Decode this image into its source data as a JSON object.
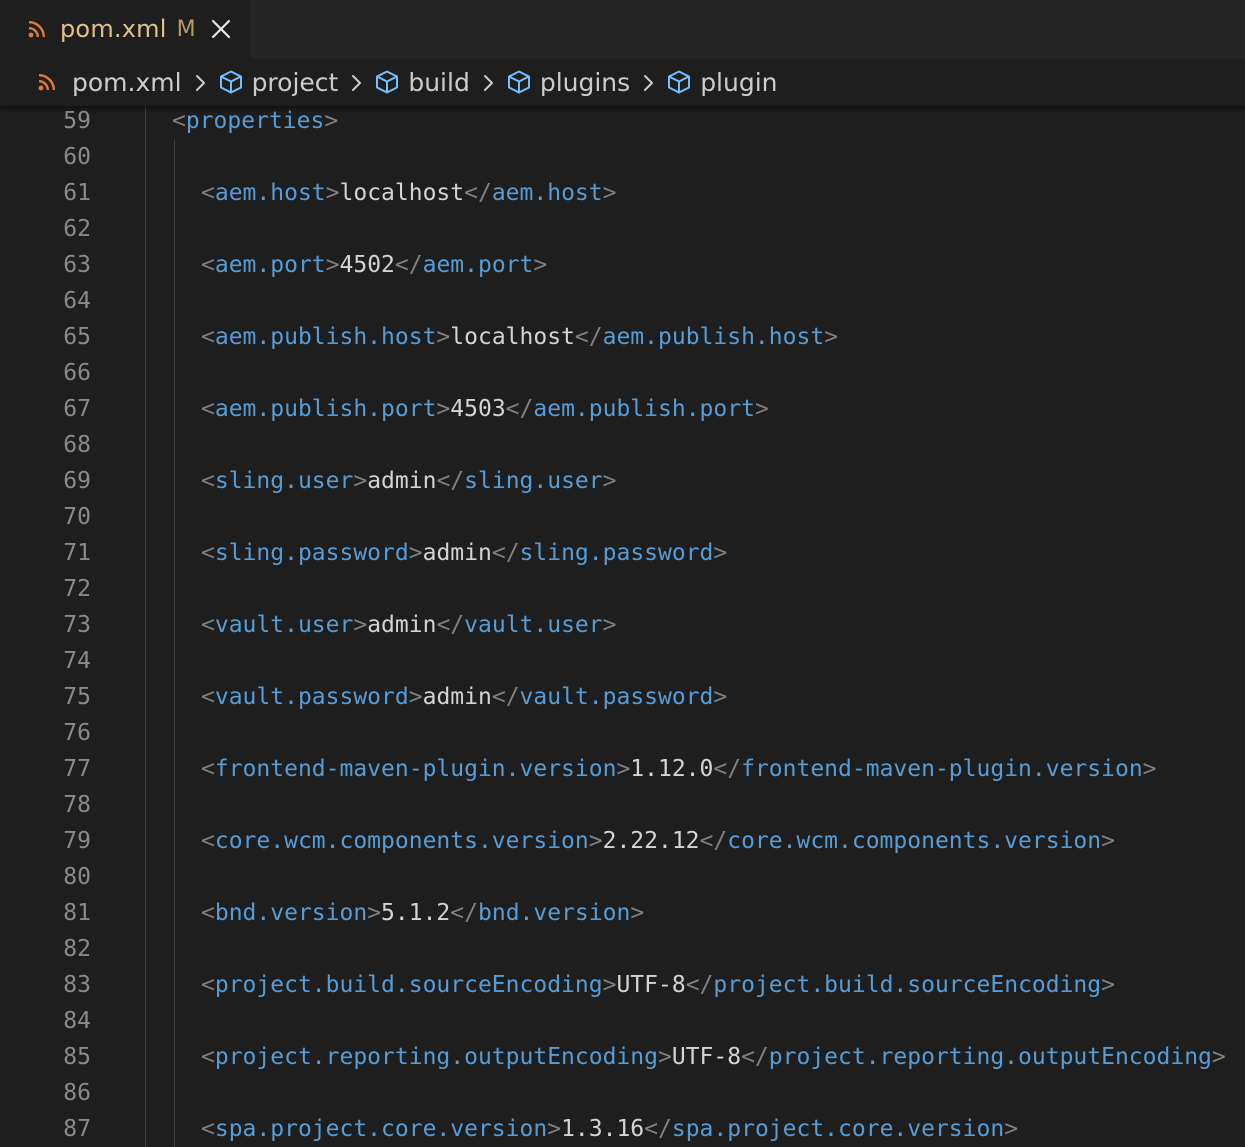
{
  "tab": {
    "title": "pom.xml",
    "status": "M"
  },
  "breadcrumb": {
    "file": "pom.xml",
    "items": [
      "project",
      "build",
      "plugins",
      "plugin"
    ]
  },
  "icons": {
    "file": "rss-icon",
    "element": "cube-icon",
    "separator": "chevron-right-icon",
    "close": "close-icon"
  },
  "colors": {
    "tag": "#569cd6",
    "punctuation": "#808080",
    "text": "#d4d4d4",
    "line_number": "#8a8a8a",
    "modified": "#e2c08d",
    "rss": "#e37933",
    "cube": "#75beff"
  },
  "editor": {
    "lines": [
      {
        "num": "59",
        "open": "properties",
        "value": "",
        "close": ""
      },
      {
        "num": "60",
        "open": "",
        "value": "",
        "close": ""
      },
      {
        "num": "61",
        "open": "aem.host",
        "value": "localhost",
        "close": "aem.host"
      },
      {
        "num": "62",
        "open": "",
        "value": "",
        "close": ""
      },
      {
        "num": "63",
        "open": "aem.port",
        "value": "4502",
        "close": "aem.port"
      },
      {
        "num": "64",
        "open": "",
        "value": "",
        "close": ""
      },
      {
        "num": "65",
        "open": "aem.publish.host",
        "value": "localhost",
        "close": "aem.publish.host"
      },
      {
        "num": "66",
        "open": "",
        "value": "",
        "close": ""
      },
      {
        "num": "67",
        "open": "aem.publish.port",
        "value": "4503",
        "close": "aem.publish.port"
      },
      {
        "num": "68",
        "open": "",
        "value": "",
        "close": ""
      },
      {
        "num": "69",
        "open": "sling.user",
        "value": "admin",
        "close": "sling.user"
      },
      {
        "num": "70",
        "open": "",
        "value": "",
        "close": ""
      },
      {
        "num": "71",
        "open": "sling.password",
        "value": "admin",
        "close": "sling.password"
      },
      {
        "num": "72",
        "open": "",
        "value": "",
        "close": ""
      },
      {
        "num": "73",
        "open": "vault.user",
        "value": "admin",
        "close": "vault.user"
      },
      {
        "num": "74",
        "open": "",
        "value": "",
        "close": ""
      },
      {
        "num": "75",
        "open": "vault.password",
        "value": "admin",
        "close": "vault.password"
      },
      {
        "num": "76",
        "open": "",
        "value": "",
        "close": ""
      },
      {
        "num": "77",
        "open": "frontend-maven-plugin.version",
        "value": "1.12.0",
        "close": "frontend-maven-plugin.version"
      },
      {
        "num": "78",
        "open": "",
        "value": "",
        "close": ""
      },
      {
        "num": "79",
        "open": "core.wcm.components.version",
        "value": "2.22.12",
        "close": "core.wcm.components.version"
      },
      {
        "num": "80",
        "open": "",
        "value": "",
        "close": ""
      },
      {
        "num": "81",
        "open": "bnd.version",
        "value": "5.1.2",
        "close": "bnd.version"
      },
      {
        "num": "82",
        "open": "",
        "value": "",
        "close": ""
      },
      {
        "num": "83",
        "open": "project.build.sourceEncoding",
        "value": "UTF-8",
        "close": "project.build.sourceEncoding"
      },
      {
        "num": "84",
        "open": "",
        "value": "",
        "close": ""
      },
      {
        "num": "85",
        "open": "project.reporting.outputEncoding",
        "value": "UTF-8",
        "close": "project.reporting.outputEncoding"
      },
      {
        "num": "86",
        "open": "",
        "value": "",
        "close": ""
      },
      {
        "num": "87",
        "open": "spa.project.core.version",
        "value": "1.3.16",
        "close": "spa.project.core.version"
      }
    ]
  }
}
